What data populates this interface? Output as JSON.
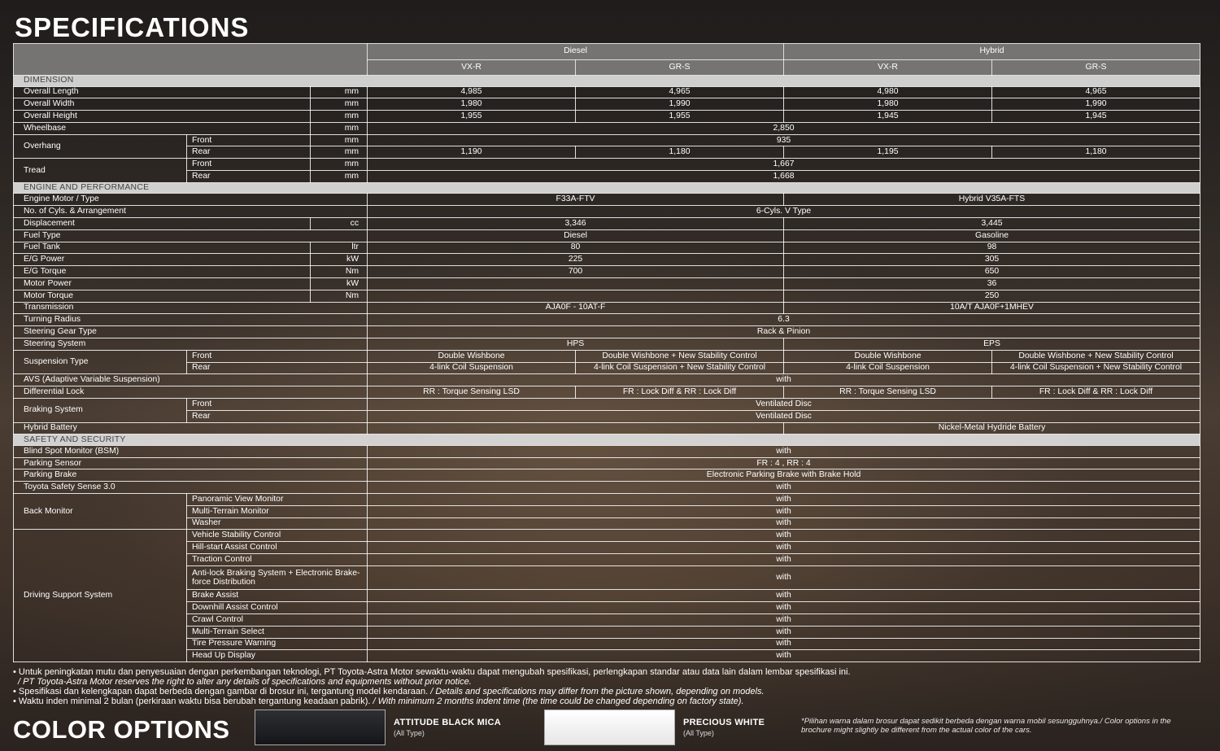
{
  "title": "SPECIFICATIONS",
  "columns": {
    "diesel": "Diesel",
    "hybrid": "Hybrid",
    "vxr": "VX-R",
    "grs": "GR-S"
  },
  "sections": {
    "dimension": "DIMENSION",
    "engine": "ENGINE AND PERFORMANCE",
    "safety": "SAFETY AND SECURITY"
  },
  "units": {
    "mm": "mm",
    "cc": "cc",
    "ltr": "ltr",
    "kw": "kW",
    "nm": "Nm"
  },
  "sub": {
    "front": "Front",
    "rear": "Rear"
  },
  "dimension": {
    "overall_length": {
      "label": "Overall Length",
      "values": [
        "4,985",
        "4,965",
        "4,980",
        "4,965"
      ]
    },
    "overall_width": {
      "label": "Overall Width",
      "values": [
        "1,980",
        "1,990",
        "1,980",
        "1,990"
      ]
    },
    "overall_height": {
      "label": "Overall Height",
      "values": [
        "1,955",
        "1,955",
        "1,945",
        "1,945"
      ]
    },
    "wheelbase": {
      "label": "Wheelbase",
      "value": "2,850"
    },
    "overhang": {
      "label": "Overhang",
      "front": "935",
      "rear": [
        "1,190",
        "1,180",
        "1,195",
        "1,180"
      ]
    },
    "tread": {
      "label": "Tread",
      "front": "1,667",
      "rear": "1,668"
    }
  },
  "engine": {
    "engine_type": {
      "label": "Engine Motor / Type",
      "diesel": "F33A-FTV",
      "hybrid": "Hybrid V35A-FTS"
    },
    "cyls": {
      "label": "No. of Cyls. & Arrangement",
      "value": "6-Cyls. V Type"
    },
    "displacement": {
      "label": "Displacement",
      "diesel": "3,346",
      "hybrid": "3,445"
    },
    "fuel_type": {
      "label": "Fuel Type",
      "diesel": "Diesel",
      "hybrid": "Gasoline"
    },
    "fuel_tank": {
      "label": "Fuel Tank",
      "diesel": "80",
      "hybrid": "98"
    },
    "eg_power": {
      "label": "E/G Power",
      "diesel": "225",
      "hybrid": "305"
    },
    "eg_torque": {
      "label": "E/G Torque",
      "diesel": "700",
      "hybrid": "650"
    },
    "motor_power": {
      "label": "Motor Power",
      "diesel": "",
      "hybrid": "36"
    },
    "motor_torque": {
      "label": "Motor Torque",
      "diesel": "",
      "hybrid": "250"
    },
    "transmission": {
      "label": "Transmission",
      "diesel": "AJA0F - 10AT-F",
      "hybrid": "10A/T AJA0F+1MHEV"
    },
    "turning_radius": {
      "label": "Turning Radius",
      "value": "6.3"
    },
    "steering_gear": {
      "label": "Steering Gear Type",
      "value": "Rack & Pinion"
    },
    "steering_system": {
      "label": "Steering System",
      "diesel": "HPS",
      "hybrid": "EPS"
    },
    "suspension": {
      "label": "Suspension Type",
      "front": [
        "Double Wishbone",
        "Double Wishbone + New Stability Control",
        "Double Wishbone",
        "Double Wishbone + New Stability Control"
      ],
      "rear": [
        "4-link Coil Suspension",
        "4-link Coil Suspension + New Stability Control",
        "4-link Coil Suspension",
        "4-link Coil Suspension + New Stability Control"
      ]
    },
    "avs": {
      "label": "AVS (Adaptive Variable Suspension)",
      "value": "with"
    },
    "diff_lock": {
      "label": "Differential Lock",
      "values": [
        "RR : Torque Sensing LSD",
        "FR : Lock Diff & RR : Lock Diff",
        "RR : Torque Sensing LSD",
        "FR : Lock Diff & RR : Lock Diff"
      ]
    },
    "braking": {
      "label": "Braking System",
      "front": "Ventilated Disc",
      "rear": "Ventilated Disc"
    },
    "hybrid_battery": {
      "label": "Hybrid Battery",
      "diesel": "",
      "hybrid": "Nickel-Metal Hydride Battery"
    }
  },
  "safety": {
    "bsm": {
      "label": "Blind Spot Monitor (BSM)",
      "value": "with"
    },
    "parking_sensor": {
      "label": "Parking Sensor",
      "value": "FR : 4 , RR : 4"
    },
    "parking_brake": {
      "label": "Parking Brake",
      "value": "Electronic Parking Brake with Brake Hold"
    },
    "tss": {
      "label": "Toyota Safety Sense 3.0",
      "value": "with"
    },
    "back_monitor": {
      "label": "Back Monitor",
      "items": [
        {
          "label": "Panoramic View Monitor",
          "value": "with"
        },
        {
          "label": "Multi-Terrain Monitor",
          "value": "with"
        },
        {
          "label": "Washer",
          "value": "with"
        }
      ]
    },
    "driving_support": {
      "label": "Driving Support System",
      "items": [
        {
          "label": "Vehicle Stability Control",
          "value": "with"
        },
        {
          "label": "Hill-start Assist Control",
          "value": "with"
        },
        {
          "label": "Traction Control",
          "value": "with"
        },
        {
          "label": "Anti-lock Braking System + Electronic Brake-force Distribution",
          "value": "with"
        },
        {
          "label": "Brake Assist",
          "value": "with"
        },
        {
          "label": "Downhill Assist Control",
          "value": "with"
        },
        {
          "label": "Crawl Control",
          "value": "with"
        },
        {
          "label": "Multi-Terrain Select",
          "value": "with"
        },
        {
          "label": "Tire Pressure Warning",
          "value": "with"
        },
        {
          "label": "Head Up Display",
          "value": "with"
        }
      ]
    }
  },
  "notes": {
    "n1_id": "• Untuk peningkatan mutu dan penyesuaian dengan perkembangan teknologi, PT Toyota-Astra Motor sewaktu-waktu dapat mengubah spesifikasi, perlengkapan standar atau data lain dalam lembar spesifikasi ini.",
    "n1_en": "/ PT Toyota-Astra Motor reserves the right to alter any details of specifications and equipments without prior notice.",
    "n2_id": "• Spesifikasi dan kelengkapan dapat berbeda dengan gambar di brosur ini, tergantung model kendaraan.",
    "n2_en": "/ Details and specifications may differ from the picture shown, depending on models.",
    "n3_id": "• Waktu inden minimal 2 bulan (perkiraan waktu bisa berubah tergantung keadaan pabrik).",
    "n3_en": "/ With minimum 2 months indent time (the time could be changed depending on factory state)."
  },
  "color_options": {
    "title": "COLOR OPTIONS",
    "colors": [
      {
        "name": "ATTITUDE BLACK MICA",
        "sub": "(All Type)",
        "hex": "#1c1d21"
      },
      {
        "name": "PRECIOUS WHITE",
        "sub": "(All Type)",
        "hex": "#f4f4f4"
      }
    ],
    "note": "*Pilihan warna dalam brosur dapat sedikit berbeda dengan warna mobil sesungguhnya./ Color options in the brochure might slightly be different from the actual color of the cars."
  }
}
